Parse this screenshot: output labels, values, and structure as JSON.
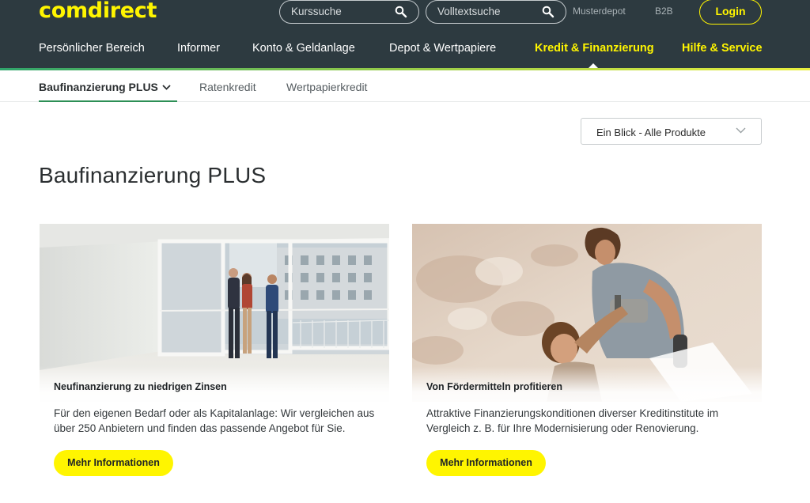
{
  "header": {
    "logo_text": "comdirect",
    "search_1_placeholder": "Kurssuche",
    "search_2_placeholder": "Volltextsuche",
    "link_musterdepot": "Musterdepot",
    "link_b2b": "B2B",
    "login_label": "Login"
  },
  "main_nav": [
    {
      "label": "Persönlicher Bereich"
    },
    {
      "label": "Informer"
    },
    {
      "label": "Konto & Geldanlage"
    },
    {
      "label": "Depot & Wertpapiere"
    },
    {
      "label": "Kredit & Finanzierung",
      "active": true
    },
    {
      "label": "Hilfe & Service"
    }
  ],
  "sub_nav": [
    {
      "label": "Baufinanzierung PLUS",
      "active": true
    },
    {
      "label": "Ratenkredit"
    },
    {
      "label": "Wertpapierkredit"
    }
  ],
  "product_select": {
    "value": "Ein Blick - Alle Produkte"
  },
  "page_title": "Baufinanzierung PLUS",
  "cards": [
    {
      "title": "Neufinanzierung zu niedrigen Zinsen",
      "text": "Für den eigenen Bedarf oder als Kapitalanlage: Wir vergleichen aus über 250 Anbietern und finden das passende Angebot für Sie.",
      "button_label": "Mehr Informationen",
      "image": "apartment-viewing-photo"
    },
    {
      "title": "Von Fördermitteln profitieren",
      "text": "Attraktive Finanzierungskonditionen diverser Kreditinstitute im Vergleich z. B. für Ihre Modernisierung oder Renovierung.",
      "button_label": "Mehr Informationen",
      "image": "renovation-family-photo"
    }
  ],
  "colors": {
    "header_bg": "#2d3a40",
    "brand_yellow": "#fff500",
    "accent_green": "#2d8f56"
  }
}
